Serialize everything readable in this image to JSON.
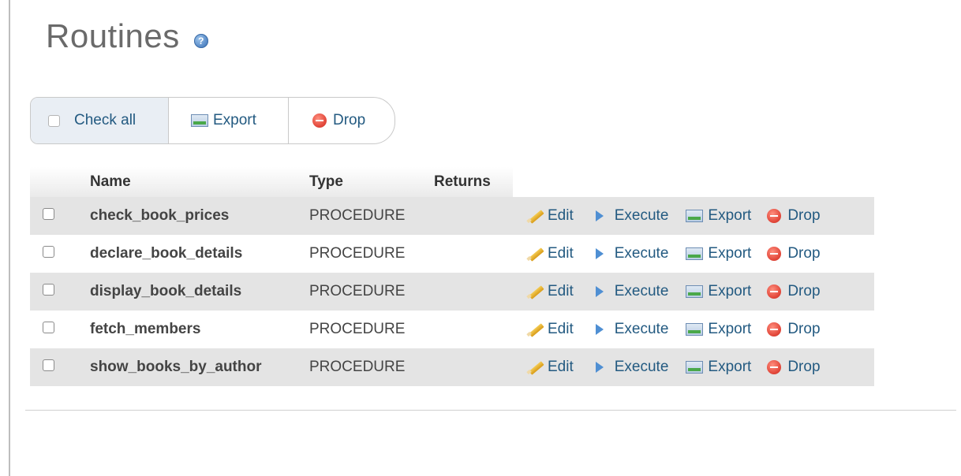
{
  "header": {
    "title": "Routines",
    "help_icon": "help-icon"
  },
  "toolbar": {
    "check_all_label": "Check all",
    "export_label": "Export",
    "drop_label": "Drop"
  },
  "table": {
    "columns": [
      "Name",
      "Type",
      "Returns"
    ],
    "rows": [
      {
        "name": "check_book_prices",
        "type": "PROCEDURE",
        "returns": ""
      },
      {
        "name": "declare_book_details",
        "type": "PROCEDURE",
        "returns": ""
      },
      {
        "name": "display_book_details",
        "type": "PROCEDURE",
        "returns": ""
      },
      {
        "name": "fetch_members",
        "type": "PROCEDURE",
        "returns": ""
      },
      {
        "name": "show_books_by_author",
        "type": "PROCEDURE",
        "returns": ""
      }
    ],
    "actions": {
      "edit": "Edit",
      "execute": "Execute",
      "export": "Export",
      "drop": "Drop"
    }
  },
  "colors": {
    "link": "#235a81",
    "row_alt": "#e4e4e4",
    "title": "#6a6a6a"
  }
}
